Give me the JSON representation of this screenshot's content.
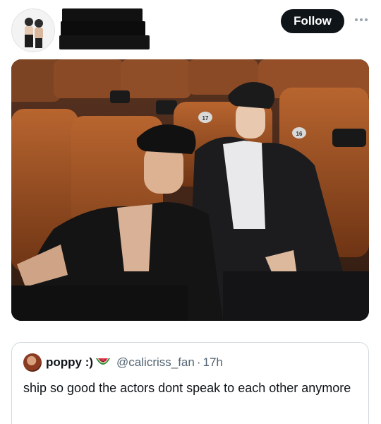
{
  "header": {
    "follow_label": "Follow",
    "more_icon": "more-horizontal-icon"
  },
  "media": {
    "seat_numbers": [
      "17",
      "16"
    ]
  },
  "quoted": {
    "display_name": "poppy :)",
    "emoji_icon": "watermelon-icon",
    "handle": "@calicriss_fan",
    "separator": "·",
    "time": "17h",
    "text": "ship so good the actors dont speak to each other anymore"
  },
  "colors": {
    "follow_bg": "#0f1419",
    "border": "#cfd9de",
    "secondary_text": "#536471"
  }
}
